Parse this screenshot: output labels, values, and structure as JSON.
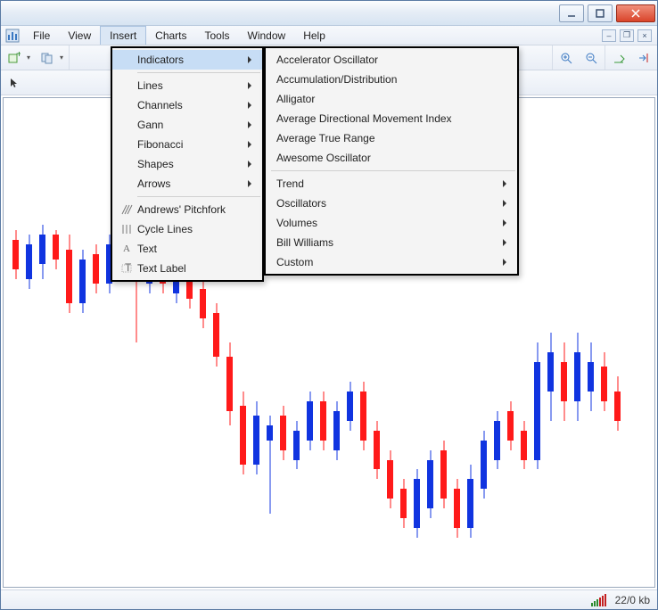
{
  "menus": {
    "file": "File",
    "view": "View",
    "insert": "Insert",
    "charts": "Charts",
    "tools": "Tools",
    "window": "Window",
    "help": "Help"
  },
  "insert_menu": {
    "indicators": "Indicators",
    "lines": "Lines",
    "channels": "Channels",
    "gann": "Gann",
    "fibonacci": "Fibonacci",
    "shapes": "Shapes",
    "arrows": "Arrows",
    "andrews": "Andrews' Pitchfork",
    "cycle": "Cycle Lines",
    "text": "Text",
    "textlabel": "Text Label"
  },
  "indicators_menu": {
    "accelerator": "Accelerator Oscillator",
    "accumulation": "Accumulation/Distribution",
    "alligator": "Alligator",
    "adx": "Average Directional Movement Index",
    "atr": "Average True Range",
    "awesome": "Awesome Oscillator",
    "trend": "Trend",
    "oscillators": "Oscillators",
    "volumes": "Volumes",
    "billwilliams": "Bill Williams",
    "custom": "Custom"
  },
  "status": {
    "traffic": "22/0 kb"
  },
  "chart_data": {
    "type": "candlestick",
    "note": "Approximate OHLC candles read from pixels; values are relative positions (0=top of chart, 1=bottom).",
    "candles": [
      {
        "i": 0,
        "c": "red",
        "h": 0.27,
        "l": 0.37,
        "o": 0.29,
        "cl": 0.35
      },
      {
        "i": 1,
        "c": "blue",
        "h": 0.28,
        "l": 0.39,
        "o": 0.37,
        "cl": 0.3
      },
      {
        "i": 2,
        "c": "blue",
        "h": 0.26,
        "l": 0.37,
        "o": 0.34,
        "cl": 0.28
      },
      {
        "i": 3,
        "c": "red",
        "h": 0.27,
        "l": 0.35,
        "o": 0.28,
        "cl": 0.33
      },
      {
        "i": 4,
        "c": "red",
        "h": 0.28,
        "l": 0.44,
        "o": 0.31,
        "cl": 0.42
      },
      {
        "i": 5,
        "c": "blue",
        "h": 0.31,
        "l": 0.44,
        "o": 0.42,
        "cl": 0.33
      },
      {
        "i": 6,
        "c": "red",
        "h": 0.3,
        "l": 0.4,
        "o": 0.32,
        "cl": 0.38
      },
      {
        "i": 7,
        "c": "blue",
        "h": 0.28,
        "l": 0.4,
        "o": 0.38,
        "cl": 0.3
      },
      {
        "i": 8,
        "c": "red",
        "h": 0.29,
        "l": 0.37,
        "o": 0.3,
        "cl": 0.35
      },
      {
        "i": 9,
        "c": "red",
        "h": 0.3,
        "l": 0.5,
        "o": 0.33,
        "cl": 0.36
      },
      {
        "i": 10,
        "c": "blue",
        "h": 0.3,
        "l": 0.4,
        "o": 0.38,
        "cl": 0.32
      },
      {
        "i": 11,
        "c": "red",
        "h": 0.3,
        "l": 0.4,
        "o": 0.32,
        "cl": 0.38
      },
      {
        "i": 12,
        "c": "blue",
        "h": 0.33,
        "l": 0.42,
        "o": 0.4,
        "cl": 0.35
      },
      {
        "i": 13,
        "c": "red",
        "h": 0.33,
        "l": 0.43,
        "o": 0.35,
        "cl": 0.41
      },
      {
        "i": 14,
        "c": "red",
        "h": 0.37,
        "l": 0.47,
        "o": 0.39,
        "cl": 0.45
      },
      {
        "i": 15,
        "c": "red",
        "h": 0.42,
        "l": 0.55,
        "o": 0.44,
        "cl": 0.53
      },
      {
        "i": 16,
        "c": "red",
        "h": 0.5,
        "l": 0.67,
        "o": 0.53,
        "cl": 0.64
      },
      {
        "i": 17,
        "c": "red",
        "h": 0.6,
        "l": 0.77,
        "o": 0.63,
        "cl": 0.75
      },
      {
        "i": 18,
        "c": "blue",
        "h": 0.62,
        "l": 0.77,
        "o": 0.75,
        "cl": 0.65
      },
      {
        "i": 19,
        "c": "blue",
        "h": 0.65,
        "l": 0.85,
        "o": 0.7,
        "cl": 0.67
      },
      {
        "i": 20,
        "c": "red",
        "h": 0.63,
        "l": 0.74,
        "o": 0.65,
        "cl": 0.72
      },
      {
        "i": 21,
        "c": "blue",
        "h": 0.66,
        "l": 0.76,
        "o": 0.74,
        "cl": 0.68
      },
      {
        "i": 22,
        "c": "blue",
        "h": 0.6,
        "l": 0.72,
        "o": 0.7,
        "cl": 0.62
      },
      {
        "i": 23,
        "c": "red",
        "h": 0.6,
        "l": 0.72,
        "o": 0.62,
        "cl": 0.7
      },
      {
        "i": 24,
        "c": "blue",
        "h": 0.62,
        "l": 0.74,
        "o": 0.72,
        "cl": 0.64
      },
      {
        "i": 25,
        "c": "blue",
        "h": 0.58,
        "l": 0.68,
        "o": 0.66,
        "cl": 0.6
      },
      {
        "i": 26,
        "c": "red",
        "h": 0.58,
        "l": 0.72,
        "o": 0.6,
        "cl": 0.7
      },
      {
        "i": 27,
        "c": "red",
        "h": 0.66,
        "l": 0.78,
        "o": 0.68,
        "cl": 0.76
      },
      {
        "i": 28,
        "c": "red",
        "h": 0.72,
        "l": 0.84,
        "o": 0.74,
        "cl": 0.82
      },
      {
        "i": 29,
        "c": "red",
        "h": 0.78,
        "l": 0.88,
        "o": 0.8,
        "cl": 0.86
      },
      {
        "i": 30,
        "c": "blue",
        "h": 0.76,
        "l": 0.9,
        "o": 0.88,
        "cl": 0.78
      },
      {
        "i": 31,
        "c": "blue",
        "h": 0.72,
        "l": 0.86,
        "o": 0.84,
        "cl": 0.74
      },
      {
        "i": 32,
        "c": "red",
        "h": 0.7,
        "l": 0.84,
        "o": 0.72,
        "cl": 0.82
      },
      {
        "i": 33,
        "c": "red",
        "h": 0.78,
        "l": 0.9,
        "o": 0.8,
        "cl": 0.88
      },
      {
        "i": 34,
        "c": "blue",
        "h": 0.75,
        "l": 0.9,
        "o": 0.88,
        "cl": 0.78
      },
      {
        "i": 35,
        "c": "blue",
        "h": 0.68,
        "l": 0.82,
        "o": 0.8,
        "cl": 0.7
      },
      {
        "i": 36,
        "c": "blue",
        "h": 0.64,
        "l": 0.76,
        "o": 0.74,
        "cl": 0.66
      },
      {
        "i": 37,
        "c": "red",
        "h": 0.62,
        "l": 0.72,
        "o": 0.64,
        "cl": 0.7
      },
      {
        "i": 38,
        "c": "red",
        "h": 0.66,
        "l": 0.76,
        "o": 0.68,
        "cl": 0.74
      },
      {
        "i": 39,
        "c": "blue",
        "h": 0.5,
        "l": 0.76,
        "o": 0.74,
        "cl": 0.54
      },
      {
        "i": 40,
        "c": "blue",
        "h": 0.48,
        "l": 0.66,
        "o": 0.6,
        "cl": 0.52
      },
      {
        "i": 41,
        "c": "red",
        "h": 0.5,
        "l": 0.66,
        "o": 0.54,
        "cl": 0.62
      },
      {
        "i": 42,
        "c": "blue",
        "h": 0.48,
        "l": 0.66,
        "o": 0.62,
        "cl": 0.52
      },
      {
        "i": 43,
        "c": "blue",
        "h": 0.5,
        "l": 0.64,
        "o": 0.6,
        "cl": 0.54
      },
      {
        "i": 44,
        "c": "red",
        "h": 0.52,
        "l": 0.64,
        "o": 0.55,
        "cl": 0.62
      },
      {
        "i": 45,
        "c": "red",
        "h": 0.57,
        "l": 0.68,
        "o": 0.6,
        "cl": 0.66
      }
    ]
  }
}
